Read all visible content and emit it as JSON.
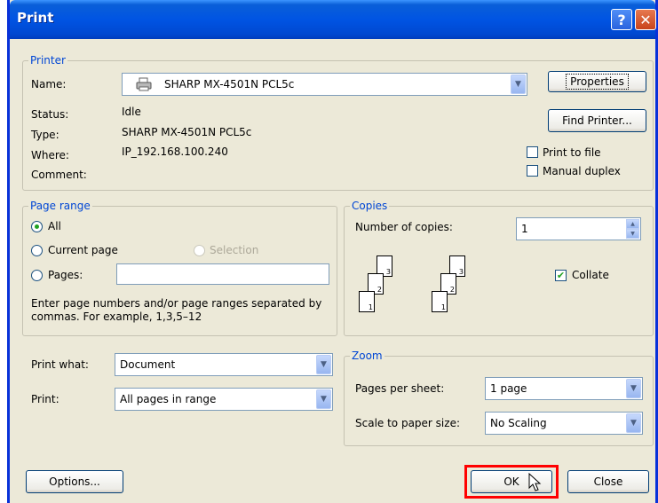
{
  "window": {
    "title": "Print"
  },
  "printer": {
    "group_label": "Printer",
    "name_label": "Name:",
    "name_value": "SHARP MX-4501N PCL5c",
    "status_label": "Status:",
    "status_value": "Idle",
    "type_label": "Type:",
    "type_value": "SHARP MX-4501N PCL5c",
    "where_label": "Where:",
    "where_value": "IP_192.168.100.240",
    "comment_label": "Comment:",
    "comment_value": "",
    "properties_label": "Properties",
    "find_printer_label": "Find Printer...",
    "print_to_file_label": "Print to file",
    "print_to_file_checked": false,
    "manual_duplex_label": "Manual duplex",
    "manual_duplex_checked": false
  },
  "page_range": {
    "group_label": "Page range",
    "all_label": "All",
    "current_page_label": "Current page",
    "selection_label": "Selection",
    "pages_label": "Pages:",
    "pages_value": "",
    "selected": "all",
    "hint": "Enter page numbers and/or page ranges separated by commas.  For example, 1,3,5–12"
  },
  "copies": {
    "group_label": "Copies",
    "number_label": "Number of copies:",
    "number_value": "1",
    "collate_label": "Collate",
    "collate_checked": true,
    "page_numbers": [
      "3",
      "2",
      "1"
    ]
  },
  "print_what": {
    "label": "Print what:",
    "value": "Document"
  },
  "print": {
    "label": "Print:",
    "value": "All pages in range"
  },
  "zoom": {
    "group_label": "Zoom",
    "pages_per_sheet_label": "Pages per sheet:",
    "pages_per_sheet_value": "1 page",
    "scale_label": "Scale to paper size:",
    "scale_value": "No Scaling"
  },
  "buttons": {
    "options_label": "Options...",
    "ok_label": "OK",
    "close_label": "Close"
  },
  "colors": {
    "titlebar": "#0054e3",
    "dialog_bg": "#ece9d8",
    "group_label": "#0046d5",
    "ok_highlight": "#ff0000"
  }
}
